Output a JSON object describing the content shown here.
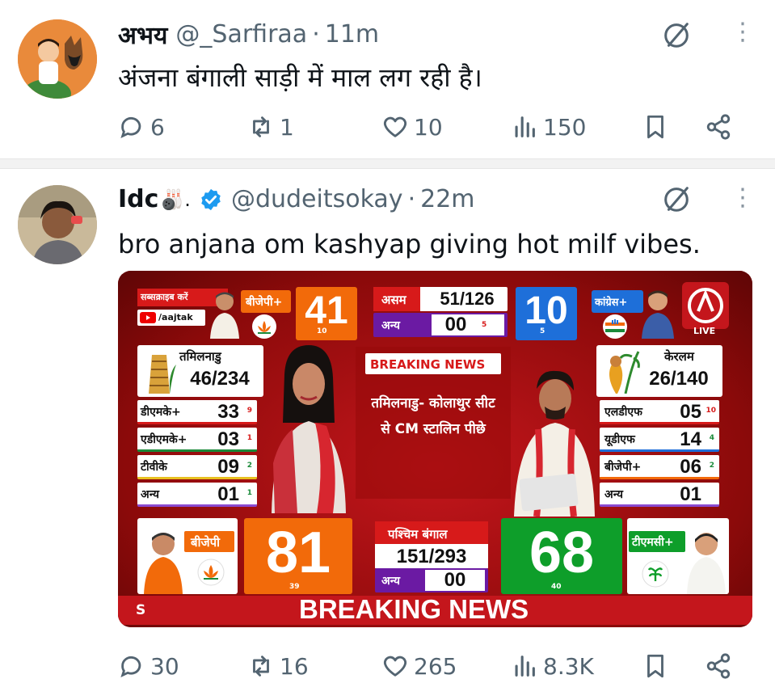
{
  "tweets": [
    {
      "name": "अभय",
      "handle": "@_Sarfiraa",
      "separator": "·",
      "time": "11m",
      "text": "अंजना बंगाली साड़ी में माल लग रही है।",
      "replies": "6",
      "reposts": "1",
      "likes": "10",
      "views": "150"
    },
    {
      "name": "Idc",
      "name_emoji": "🎳.",
      "handle": "@dudeitsokay",
      "separator": "·",
      "time": "22m",
      "text": "bro anjana om kashyap giving hot milf vibes.",
      "replies": "30",
      "reposts": "16",
      "likes": "265",
      "views": "8.3K"
    }
  ],
  "colors": {
    "verified": "#1d9bf0",
    "bjp_orange": "#f26a0a",
    "congress_blue": "#1e6fd9",
    "tmc_green": "#0e9e2a",
    "purple": "#6b1aa3",
    "news_red": "#c4161c"
  },
  "icons": [
    "reply-icon",
    "repost-icon",
    "like-icon",
    "views-icon",
    "bookmark-icon",
    "share-icon",
    "grok-icon",
    "more-icon",
    "verified-icon"
  ],
  "tv": {
    "subscribe": "सब्सक्राइब करें",
    "channel_handle": "/aajtak",
    "bjp_plus": "बीजेपी+",
    "bjp_plus_num": "41",
    "bjp_plus_sub": "10",
    "assam": "असम",
    "assam_total": "51/126",
    "assam_other": "अन्य",
    "assam_other_num": "00",
    "assam_other_sub": "5",
    "congress_num": "10",
    "congress_sub": "5",
    "congress": "कांग्रेस+",
    "live": "LIVE",
    "tn": "तमिलनाडु",
    "tn_total": "46/234",
    "tn_rows": [
      {
        "name": "डीएमके+",
        "val": "33",
        "sub": "9"
      },
      {
        "name": "एडीएमके+",
        "val": "03",
        "sub": "1"
      },
      {
        "name": "टीवीके",
        "val": "09",
        "sub": "2"
      },
      {
        "name": "अन्य",
        "val": "01",
        "sub": "1"
      }
    ],
    "breaking_small": "BREAKING NEWS",
    "headline": "तमिलनाडु- कोलाथुर सीट से CM स्टालिन पीछे",
    "kerala": "केरलम",
    "kerala_total": "26/140",
    "kerala_rows": [
      {
        "name": "एलडीएफ",
        "val": "05",
        "sub": "10"
      },
      {
        "name": "यूडीएफ",
        "val": "14",
        "sub": "4"
      },
      {
        "name": "बीजेपी+",
        "val": "06",
        "sub": "2"
      },
      {
        "name": "अन्य",
        "val": "01",
        "sub": ""
      }
    ],
    "bjp": "बीजेपी",
    "bjp_num": "81",
    "bjp_sub": "39",
    "wb": "पश्चिम बंगाल",
    "wb_total": "151/293",
    "wb_other": "अन्य",
    "wb_other_num": "00",
    "tmc_num": "68",
    "tmc_sub": "40",
    "tmc": "टीएमसी+",
    "breaking_big": "BREAKING NEWS",
    "ticker_left": "S"
  }
}
